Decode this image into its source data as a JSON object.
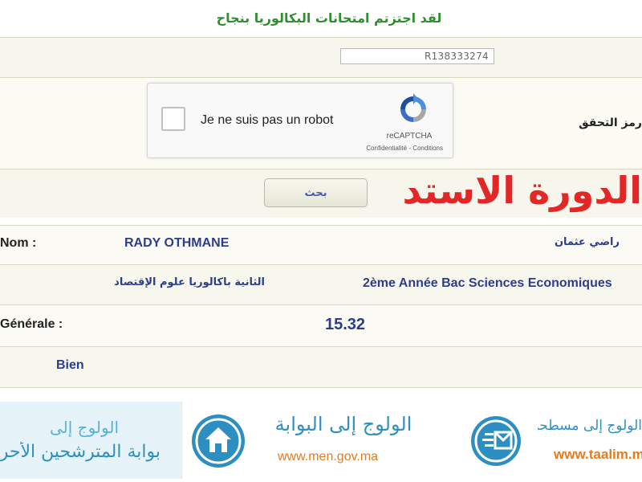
{
  "header": {
    "title": "لقد اجتزتم امتحانات البكالوريا بنجاح"
  },
  "form": {
    "code_value": "R138333274",
    "verify_label": "رمز التحقق :",
    "recaptcha": {
      "checkbox_label": "Je ne suis pas un robot",
      "brand": "reCAPTCHA",
      "links": "Confidentialité - Conditions"
    },
    "search_button": "بحث"
  },
  "overlay_text": "الدورة الاستدراكية",
  "result": {
    "name_label": "Nom :",
    "name_fr": "RADY OTHMANE",
    "name_ar": "راضي عثمان",
    "branch_ar": "الثانية باكالوريا علوم الإقتصاد",
    "branch_fr": "2ème Année Bac Sciences Economiques",
    "average_label": "Générale :",
    "average_value": "15.32",
    "mention": "Bien"
  },
  "banners": [
    {
      "line1": "الولوج إلى",
      "line2": "بوابة المترشحين الأحرار"
    },
    {
      "line1": "الولوج إلى البوابة",
      "url": "www.men.gov.ma",
      "icon": "home-icon"
    },
    {
      "line1": "الولوج إلى مسطحة",
      "url": "www.taalim.ma",
      "icon": "mail-icon"
    }
  ],
  "colors": {
    "accent_red": "#e32727",
    "title_green": "#2f8f2f",
    "value_blue": "#2c3d8c",
    "banner_blue": "#2d8fc1",
    "url_orange": "#e07c22"
  }
}
